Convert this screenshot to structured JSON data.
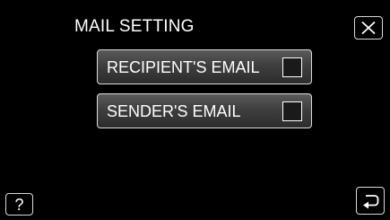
{
  "screen": {
    "title": "MAIL SETTING"
  },
  "icons": {
    "close": "close-icon",
    "help": "help-icon",
    "back": "back-icon"
  },
  "buttons": {
    "help_label": "?"
  },
  "menu": {
    "items": [
      {
        "label": "RECIPIENT'S EMAIL",
        "checked": false
      },
      {
        "label": "SENDER'S EMAIL",
        "checked": false
      }
    ]
  }
}
